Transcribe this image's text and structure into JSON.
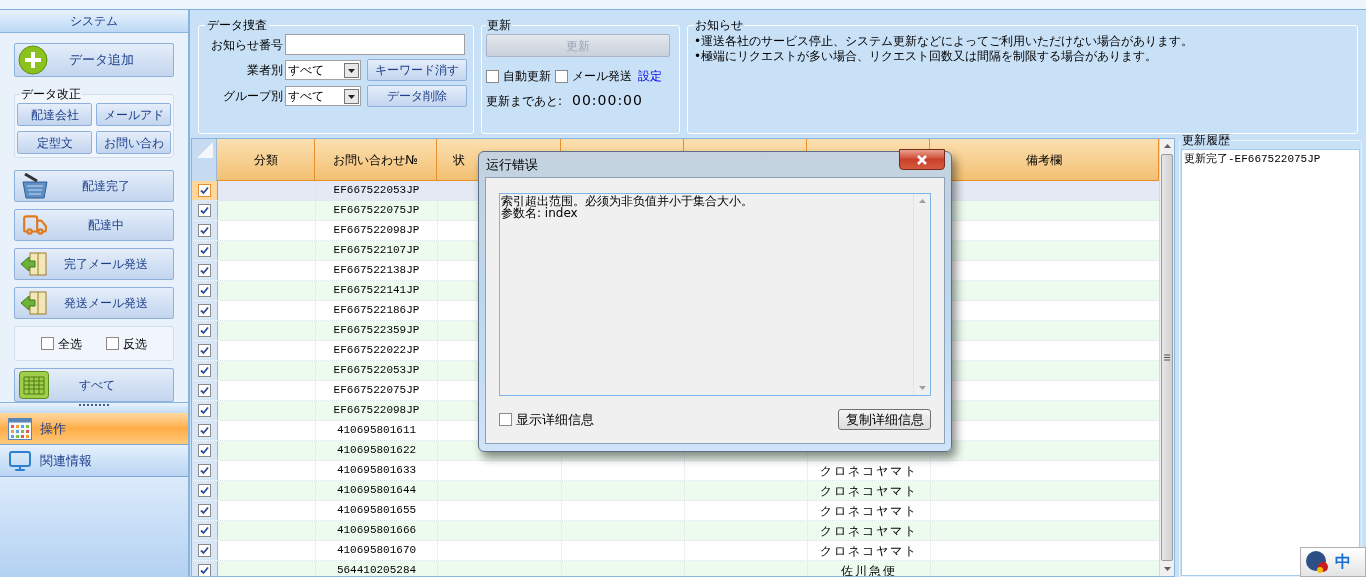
{
  "sidebar": {
    "title": "システム",
    "add_button": "データ追加",
    "edit_group": {
      "title": "データ改正",
      "buttons": [
        "配達会社",
        "メールアド",
        "定型文",
        "お問い合わ"
      ]
    },
    "actions": [
      {
        "label": "配達完了",
        "kind": "basket"
      },
      {
        "label": "配達中",
        "kind": "truck"
      },
      {
        "label": "完了メール発送",
        "kind": "book"
      },
      {
        "label": "発送メール発送",
        "kind": "book"
      }
    ],
    "select": [
      {
        "label": "全选",
        "checked": false
      },
      {
        "label": "反选",
        "checked": false
      }
    ],
    "all_button": "すべて",
    "nav": [
      {
        "label": "操作",
        "selected": true,
        "kind": "grid"
      },
      {
        "label": "関連情報",
        "selected": false,
        "kind": "monitor"
      }
    ]
  },
  "search": {
    "title": "データ捜査",
    "notice_no_label": "お知らせ番号",
    "vendor": {
      "label": "業者別",
      "value": "すべて"
    },
    "group": {
      "label": "グループ別",
      "value": "すべて"
    },
    "clear_button": "キーワード消す",
    "delete_button": "データ削除"
  },
  "update": {
    "title": "更新",
    "button": "更新",
    "disabled": true,
    "auto": {
      "label": "自動更新",
      "checked": false
    },
    "mail": {
      "label": "メール発送",
      "checked": false
    },
    "settings_link": "設定",
    "countdown_label": "更新まであと:",
    "countdown": "00:00:00"
  },
  "notice": {
    "title": "お知らせ",
    "lines": [
      "•運送各社のサービス停止、システム更新などによってご利用いただけない場合があります。",
      "•極端にリクエストが多い場合、リクエスト回数又は間隔を制限する場合があります。"
    ]
  },
  "table": {
    "columns": {
      "category": "分類",
      "tracking_no": "お問い合わせ№",
      "column_3": "状",
      "remarks": "備考欄"
    },
    "rows": [
      {
        "checked": true,
        "selected": true,
        "tracking_no": "EF667522053JP"
      },
      {
        "checked": true,
        "selected": false,
        "tracking_no": "EF667522075JP"
      },
      {
        "checked": true,
        "selected": false,
        "tracking_no": "EF667522098JP"
      },
      {
        "checked": true,
        "selected": false,
        "tracking_no": "EF667522107JP"
      },
      {
        "checked": true,
        "selected": false,
        "tracking_no": "EF667522138JP"
      },
      {
        "checked": true,
        "selected": false,
        "tracking_no": "EF667522141JP"
      },
      {
        "checked": true,
        "selected": false,
        "tracking_no": "EF667522186JP"
      },
      {
        "checked": true,
        "selected": false,
        "tracking_no": "EF667522359JP"
      },
      {
        "checked": true,
        "selected": false,
        "tracking_no": "EF667522022JP"
      },
      {
        "checked": true,
        "selected": false,
        "tracking_no": "EF667522053JP"
      },
      {
        "checked": true,
        "selected": false,
        "tracking_no": "EF667522075JP"
      },
      {
        "checked": true,
        "selected": false,
        "tracking_no": "EF667522098JP"
      },
      {
        "checked": true,
        "selected": false,
        "tracking_no": "410695801611"
      },
      {
        "checked": true,
        "selected": false,
        "tracking_no": "410695801622"
      },
      {
        "checked": true,
        "selected": false,
        "tracking_no": "410695801633",
        "carrier": "クロネコヤマト"
      },
      {
        "checked": true,
        "selected": false,
        "tracking_no": "410695801644",
        "carrier": "クロネコヤマト"
      },
      {
        "checked": true,
        "selected": false,
        "tracking_no": "410695801655",
        "carrier": "クロネコヤマト"
      },
      {
        "checked": true,
        "selected": false,
        "tracking_no": "410695801666",
        "carrier": "クロネコヤマト"
      },
      {
        "checked": true,
        "selected": false,
        "tracking_no": "410695801670",
        "carrier": "クロネコヤマト"
      },
      {
        "checked": true,
        "selected": false,
        "tracking_no": "564410205284",
        "carrier": "佐川急便"
      }
    ]
  },
  "history": {
    "title": "更新履歴",
    "items": [
      "更新完了-EF667522075JP"
    ]
  },
  "dialog": {
    "title": "运行错误",
    "message_lines": [
      "索引超出范围。必须为非负值并小于集合大小。",
      "参数名: index"
    ],
    "show_details": {
      "label": "显示详细信息",
      "checked": false
    },
    "copy_button": "复制详细信息"
  },
  "ime": {
    "label": "中"
  }
}
